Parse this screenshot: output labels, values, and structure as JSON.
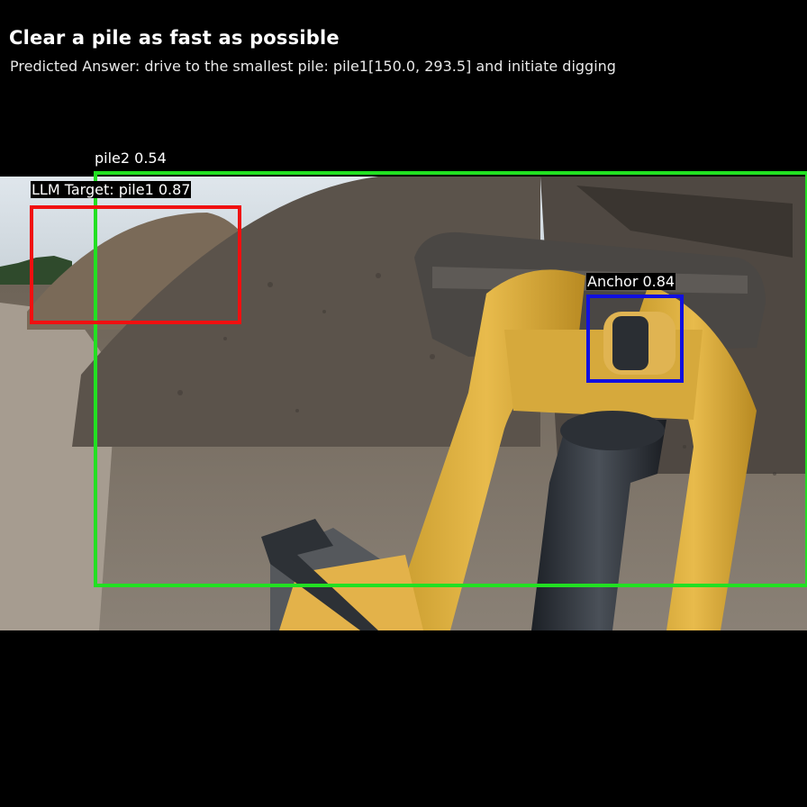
{
  "header": {
    "title": "Clear a pile as fast as possible",
    "answer": "Predicted Answer: drive to the smallest pile: pile1[150.0, 293.5] and initiate digging"
  },
  "detections": [
    {
      "id": "pile2",
      "label": "pile2 0.54",
      "color": "#22e022"
    },
    {
      "id": "llm-target",
      "label": "LLM Target: pile1 0.87",
      "color": "#f01010"
    },
    {
      "id": "anchor",
      "label": "Anchor 0.84",
      "color": "#1010e0"
    }
  ]
}
